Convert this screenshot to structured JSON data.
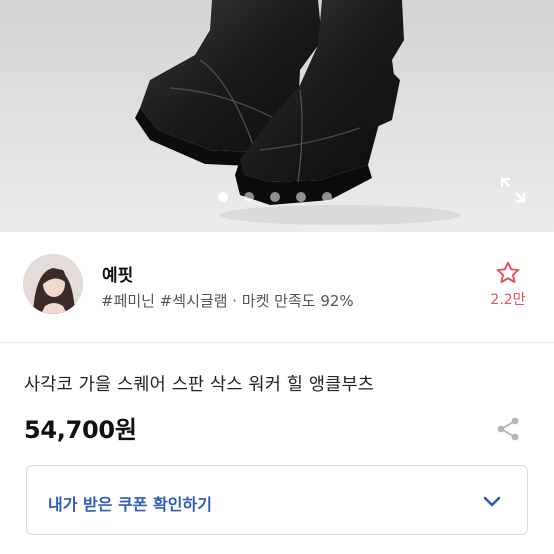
{
  "product_image": {
    "dots_count": 5,
    "active_dot": 0
  },
  "shop": {
    "name": "예핏",
    "tags": "#페미닌 #섹시글램 · 마켓 만족도 92%",
    "favorite_count": "2.2만"
  },
  "product": {
    "title": "사각코 가을 스퀘어 스판 삭스 워커 힐 앵클부츠",
    "price": "54,700원"
  },
  "coupon": {
    "label": "내가 받은 쿠폰 확인하기"
  },
  "colors": {
    "accent_blue": "#2f5bbb",
    "favorite_red": "#e8505b"
  },
  "icons": [
    "expand-icon",
    "star-outline-icon",
    "share-icon",
    "chevron-down-icon"
  ]
}
